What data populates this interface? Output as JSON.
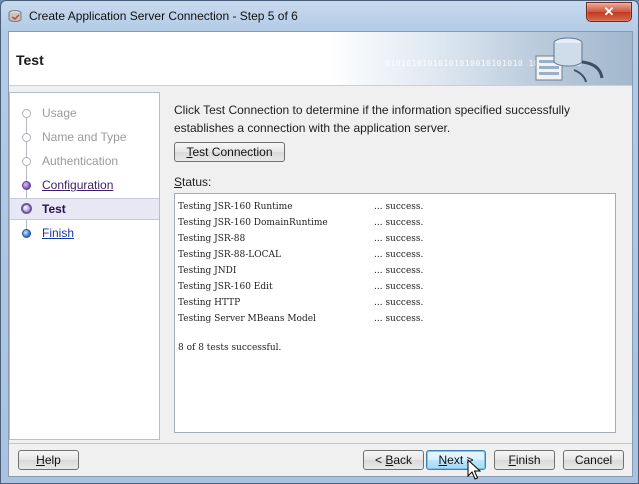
{
  "window": {
    "title": "Create Application Server Connection - Step 5 of 6",
    "close_symbol": "✕"
  },
  "header": {
    "title": "Test",
    "banner_bits": "01010101010101010010101010 1010101010"
  },
  "steps": [
    {
      "label": "Usage",
      "state": "disabled"
    },
    {
      "label": "Name and Type",
      "state": "disabled"
    },
    {
      "label": "Authentication",
      "state": "disabled"
    },
    {
      "label": "Configuration",
      "state": "link"
    },
    {
      "label": "Test",
      "state": "current"
    },
    {
      "label": "Finish",
      "state": "next"
    }
  ],
  "main": {
    "description": "Click Test Connection to determine if the information specified successfully establishes a connection with the application server.",
    "test_button": {
      "mnemonic": "T",
      "rest": "est Connection"
    },
    "status_label": {
      "mnemonic": "S",
      "rest": "tatus:"
    },
    "results": [
      {
        "name": "Testing JSR-160 Runtime",
        "result": "... success."
      },
      {
        "name": "Testing JSR-160 DomainRuntime",
        "result": "... success."
      },
      {
        "name": "Testing JSR-88",
        "result": "... success."
      },
      {
        "name": "Testing JSR-88-LOCAL",
        "result": "... success."
      },
      {
        "name": "Testing JNDI",
        "result": "... success."
      },
      {
        "name": "Testing JSR-160 Edit",
        "result": "... success."
      },
      {
        "name": "Testing HTTP",
        "result": "... success."
      },
      {
        "name": "Testing Server MBeans Model",
        "result": "... success."
      }
    ],
    "summary": "8 of 8 tests successful."
  },
  "footer": {
    "help": {
      "mnemonic": "H",
      "rest": "elp"
    },
    "back": {
      "pre": "< ",
      "mnemonic": "B",
      "rest": "ack"
    },
    "next": {
      "mnemonic": "N",
      "rest": "ext >"
    },
    "finish": {
      "mnemonic": "F",
      "rest": "inish"
    },
    "cancel": {
      "label": "Cancel"
    }
  },
  "colors": {
    "current_step": "#2b0e5a",
    "link_step": "#3e1e6b",
    "next_step": "#1636a5",
    "disabled_step": "#9b9b9b",
    "close_button": "#c9452b"
  },
  "icons": [
    "app-server-icon",
    "server-connection-icon",
    "close-icon",
    "mouse-cursor-icon"
  ]
}
